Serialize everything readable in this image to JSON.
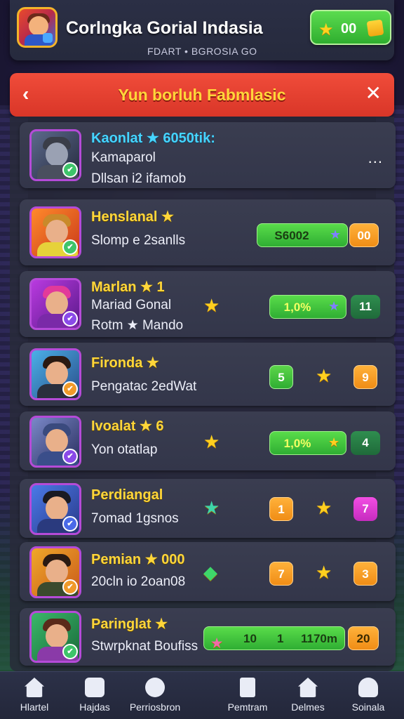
{
  "header": {
    "app_title": "Corlngka Gorial Indasia",
    "subtitle": "FDART • BGROSIA GO",
    "coins": "00"
  },
  "dialog": {
    "back_icon": "chevron-left-icon",
    "title": "Yun borluh Fabmlasic",
    "close_icon": "close-icon"
  },
  "players": [
    {
      "name": "Kaonlat ★ 6050tik:",
      "line1": "Kamaparol",
      "line2": "Dllsan i2 ifamob",
      "more": "..."
    },
    {
      "name": "Henslanal ★",
      "line1": "Slomp e 2sanlls",
      "stat_bar": "S6002",
      "orange_value": "00"
    },
    {
      "name": "Marlan ★ 1",
      "line1": "Mariad Gonal",
      "line2": "Rotm ★ Mando",
      "stat_bar": "1,0%",
      "right_value": "11"
    },
    {
      "name": "Fironda ★",
      "line1": "Pengatac 2edWat",
      "left_value": "5",
      "right_value": "9"
    },
    {
      "name": "Ivoalat ★ 6",
      "line1": "Yon otatlap",
      "stat_bar": "1,0%",
      "right_value": "4"
    },
    {
      "name": "Perdiangal",
      "line1": "7omad 1gsnos",
      "left_value": "1",
      "right_value": "7"
    },
    {
      "name": "Pemian ★ 000",
      "line1": "20cln io 2oan08",
      "left_value": "7",
      "right_value": "3"
    },
    {
      "name": "Paringlat ★",
      "line1": "Stwrpknat Boufiss",
      "bar_value1": "10",
      "bar_value2": "1",
      "bar_value3": "1170m",
      "right_value": "20"
    }
  ],
  "nav": [
    {
      "label": "Hlartel",
      "icon": "home-icon"
    },
    {
      "label": "Hajdas",
      "icon": "dice-icon"
    },
    {
      "label": "Perriosbron",
      "icon": "puzzle-icon"
    },
    {
      "label": "Pemtram",
      "icon": "tablet-icon"
    },
    {
      "label": "Delmes",
      "icon": "house-icon"
    },
    {
      "label": "Soinala",
      "icon": "user-icon"
    }
  ]
}
